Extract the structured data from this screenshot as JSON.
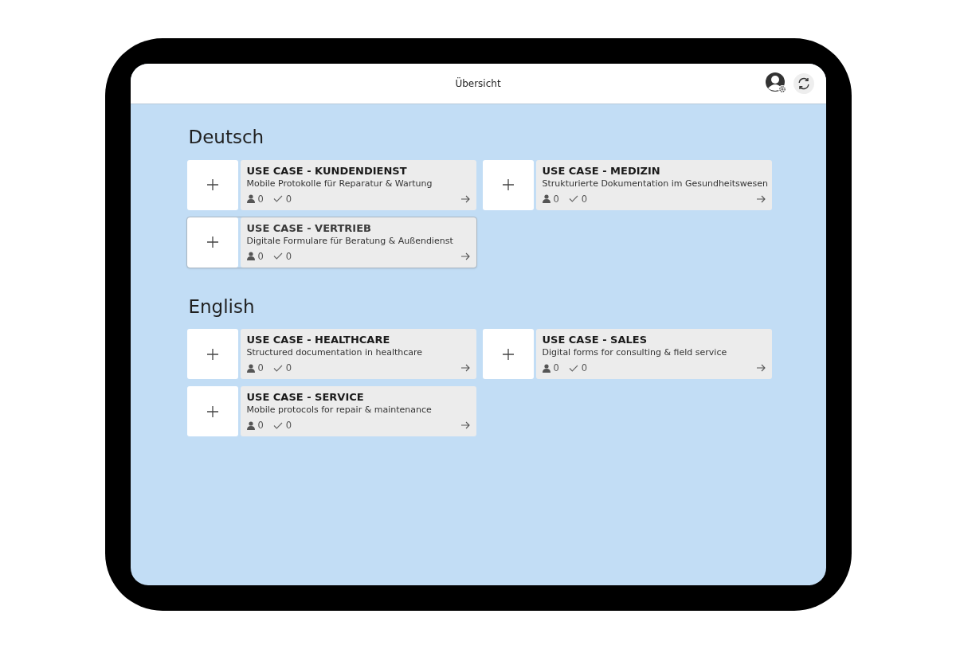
{
  "header": {
    "title": "Übersicht"
  },
  "sections": [
    {
      "heading": "Deutsch",
      "cards": [
        {
          "title": "USE CASE - KUNDENDIENST",
          "subtitle": "Mobile Protokolle für Reparatur & Wartung",
          "users": "0",
          "checks": "0",
          "selected": false
        },
        {
          "title": "USE CASE - MEDIZIN",
          "subtitle": "Strukturierte Dokumentation im Gesundheitswesen",
          "users": "0",
          "checks": "0",
          "selected": false
        },
        {
          "title": "USE CASE - VERTRIEB",
          "subtitle": "Digitale Formulare für Beratung & Außendienst",
          "users": "0",
          "checks": "0",
          "selected": true
        }
      ]
    },
    {
      "heading": "English",
      "cards": [
        {
          "title": "USE CASE - HEALTHCARE",
          "subtitle": "Structured documentation in healthcare",
          "users": "0",
          "checks": "0",
          "selected": false
        },
        {
          "title": "USE CASE - SALES",
          "subtitle": "Digital forms for consulting & field service",
          "users": "0",
          "checks": "0",
          "selected": false
        },
        {
          "title": "USE CASE - SERVICE",
          "subtitle": "Mobile protocols for repair & maintenance",
          "users": "0",
          "checks": "0",
          "selected": false
        }
      ]
    }
  ]
}
